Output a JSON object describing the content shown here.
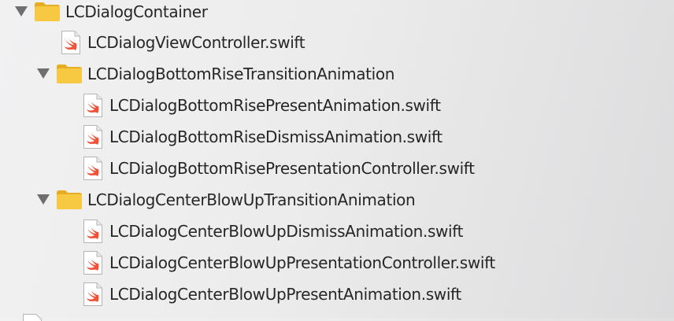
{
  "tree": {
    "root": {
      "label": "LCDialogContainer",
      "icon": "folder-icon",
      "expanded": true,
      "children": [
        {
          "label": "LCDialogViewController.swift",
          "icon": "swift-file-icon"
        },
        {
          "label": "LCDialogBottomRiseTransitionAnimation",
          "icon": "folder-icon",
          "expanded": true,
          "children": [
            {
              "label": "LCDialogBottomRisePresentAnimation.swift",
              "icon": "swift-file-icon"
            },
            {
              "label": "LCDialogBottomRiseDismissAnimation.swift",
              "icon": "swift-file-icon"
            },
            {
              "label": "LCDialogBottomRisePresentationController.swift",
              "icon": "swift-file-icon"
            }
          ]
        },
        {
          "label": "LCDialogCenterBlowUpTransitionAnimation",
          "icon": "folder-icon",
          "expanded": true,
          "children": [
            {
              "label": "LCDialogCenterBlowUpDismissAnimation.swift",
              "icon": "swift-file-icon"
            },
            {
              "label": "LCDialogCenterBlowUpPresentationController.swift",
              "icon": "swift-file-icon"
            },
            {
              "label": "LCDialogCenterBlowUpPresentAnimation.swift",
              "icon": "swift-file-icon"
            }
          ]
        }
      ]
    }
  },
  "colors": {
    "folder": "#f7c842",
    "folder_dark": "#e6ad22",
    "swift_orange": "#f05138",
    "disclosure": "#6e6e6e",
    "text": "#262626"
  }
}
